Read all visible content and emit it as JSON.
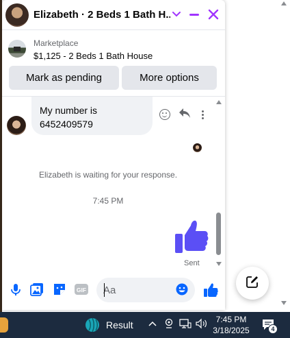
{
  "chat": {
    "title": "Elizabeth · 2 Beds 1 Bath H...",
    "listing": {
      "source": "Marketplace",
      "title": "$1,125 - 2 Beds 1 Bath House"
    },
    "actions": {
      "pending_label": "Mark as pending",
      "more_label": "More options"
    },
    "message": {
      "line1": "My number is",
      "line2": "6452409579"
    },
    "waiting_text": "Elizabeth is waiting for your response.",
    "timestamp": "7:45 PM",
    "sent_label": "Sent",
    "composer": {
      "placeholder": "Aa"
    },
    "accent_color": "#a033ff",
    "messenger_blue": "#0866ff"
  },
  "taskbar": {
    "app_label": "Result",
    "time": "7:45 PM",
    "date": "3/18/2025",
    "notification_count": "4"
  },
  "icons": [
    "chevron-down-icon",
    "minimize-icon",
    "close-icon",
    "emoji-icon",
    "reply-icon",
    "more-icon",
    "microphone-icon",
    "image-icon",
    "sticker-icon",
    "gif-icon",
    "thumbs-up-icon",
    "compose-icon"
  ]
}
